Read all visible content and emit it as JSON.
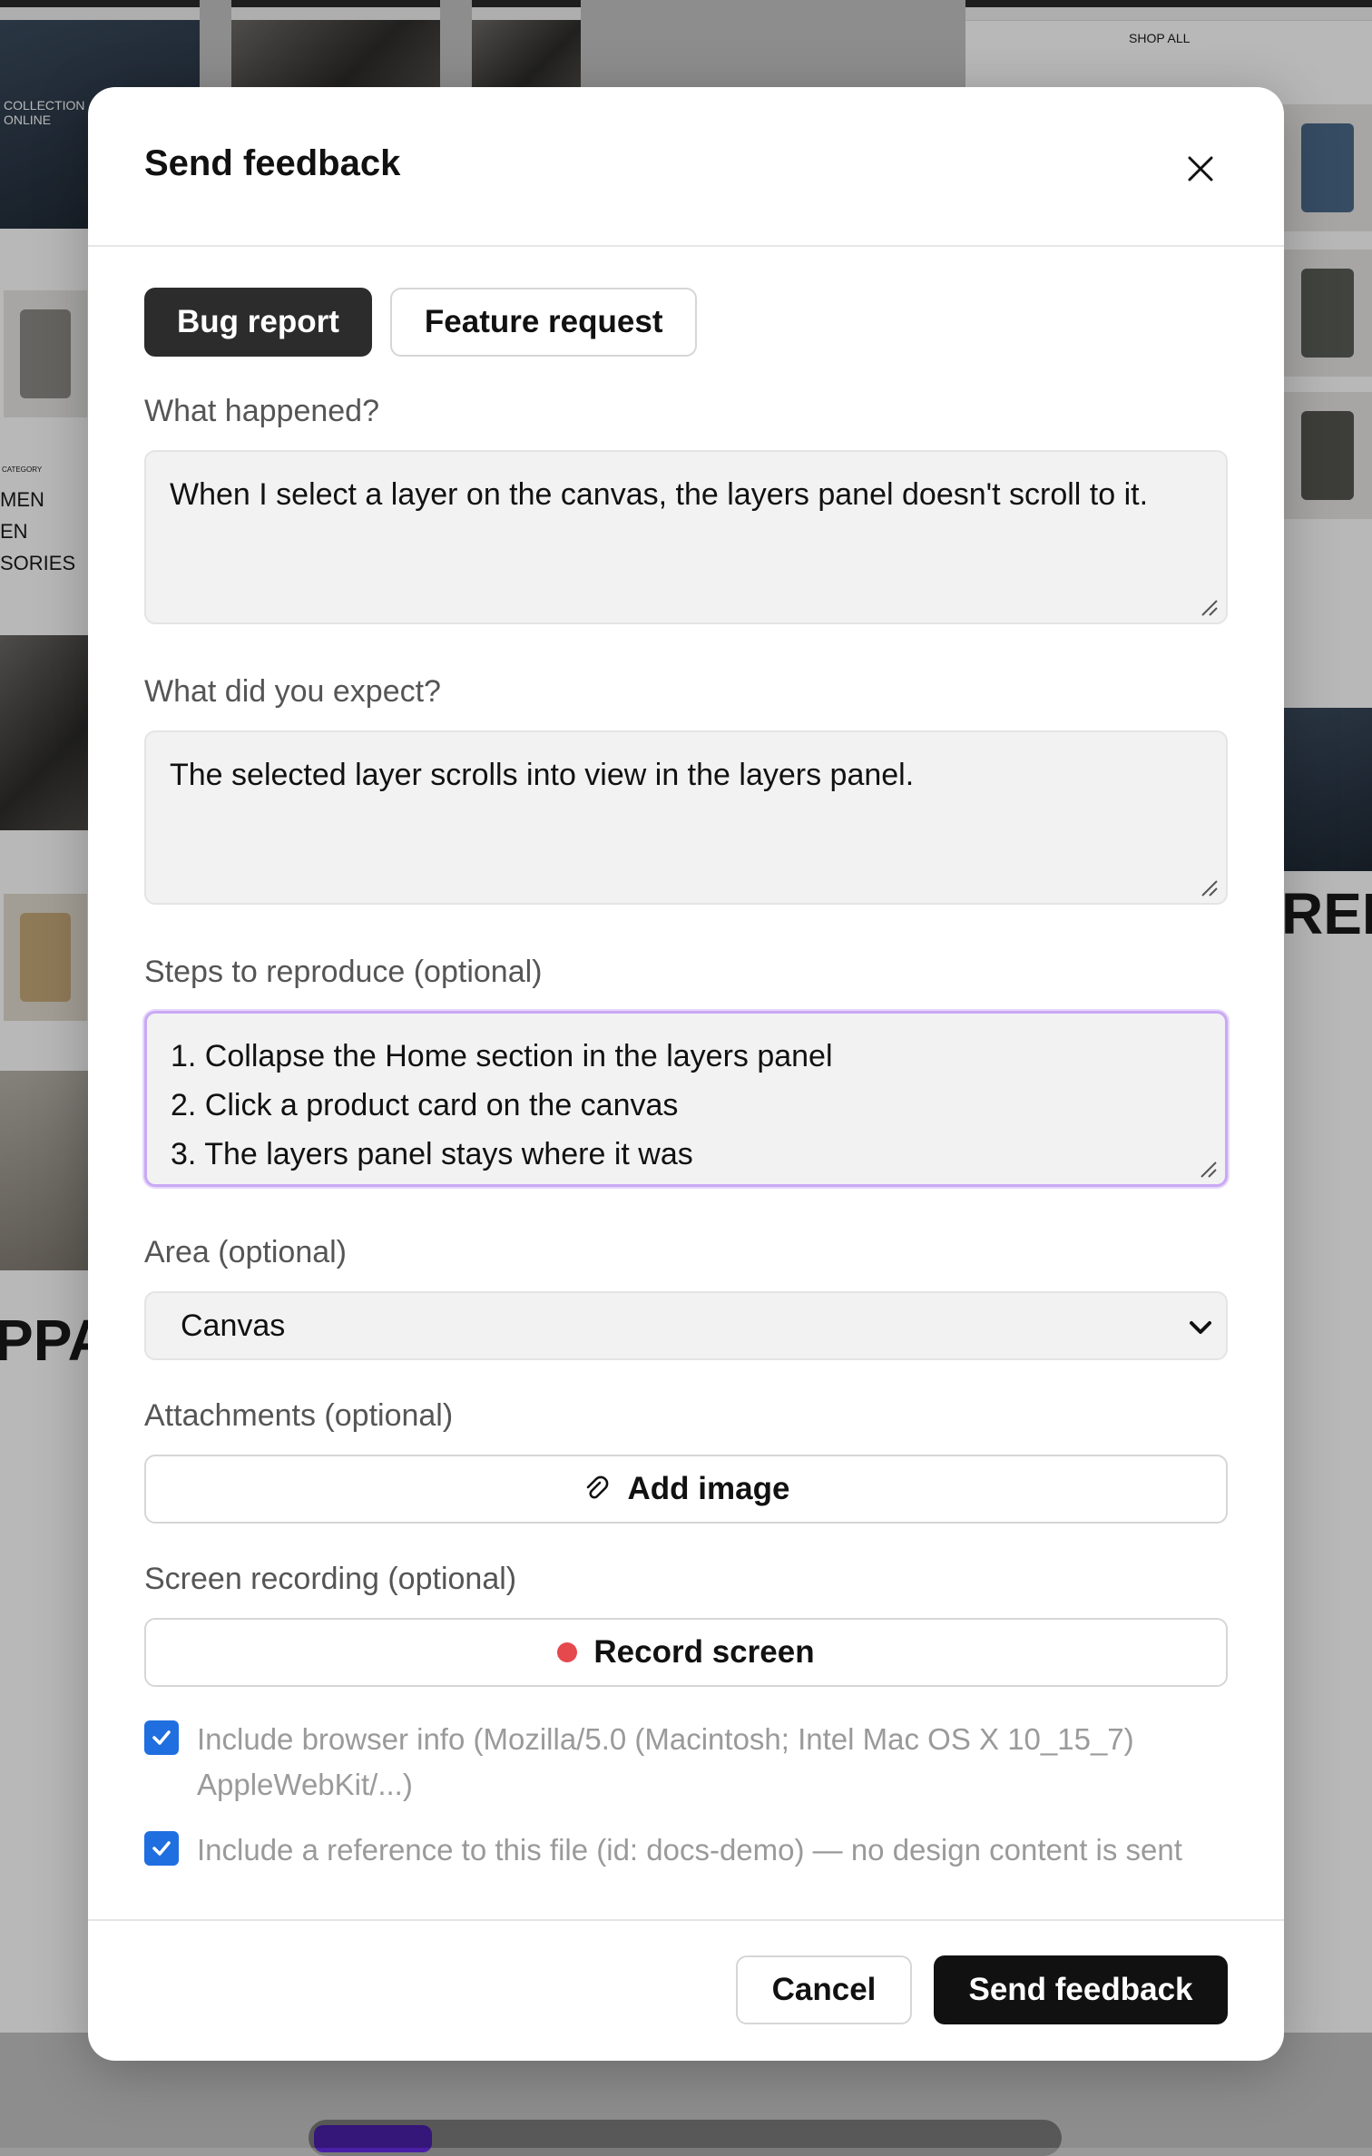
{
  "background": {
    "collection_line1": "COLLECTION",
    "collection_line2": "ONLINE",
    "shop_all": "SHOP ALL",
    "category": "CATEGORY",
    "cat_men": "MEN",
    "cat_en": "EN",
    "cat_sories": "SORIES",
    "big_ppa": "PPA",
    "big_rel": "REL"
  },
  "modal": {
    "title": "Send feedback",
    "tabs": [
      {
        "label": "Bug report",
        "active": true
      },
      {
        "label": "Feature request",
        "active": false
      }
    ],
    "fields": {
      "what_happened": {
        "label": "What happened?",
        "value": "When I select a layer on the canvas, the layers panel doesn't scroll to it."
      },
      "what_expected": {
        "label": "What did you expect?",
        "value": "The selected layer scrolls into view in the layers panel."
      },
      "steps": {
        "label": "Steps to reproduce (optional)",
        "lines": [
          "1. Collapse the Home section in the layers panel",
          "2. Click a product card on the canvas",
          "3. The layers panel stays where it was"
        ]
      },
      "area": {
        "label": "Area (optional)",
        "value": "Canvas"
      },
      "attachments": {
        "label": "Attachments (optional)",
        "button": "Add image"
      },
      "recording": {
        "label": "Screen recording (optional)",
        "button": "Record screen"
      }
    },
    "checkboxes": [
      {
        "label": "Include browser info (Mozilla/5.0 (Macintosh; Intel Mac OS X 10_15_7) AppleWebKit/...)",
        "checked": true
      },
      {
        "label": "Include a reference to this file (id: docs-demo) — no design content is sent",
        "checked": true
      }
    ],
    "footer": {
      "cancel": "Cancel",
      "send": "Send feedback"
    }
  },
  "colors": {
    "primary": "#111111",
    "checkbox": "#1f6fe0",
    "focus_ring": "#c9a9f4",
    "record_dot": "#e5484d"
  }
}
